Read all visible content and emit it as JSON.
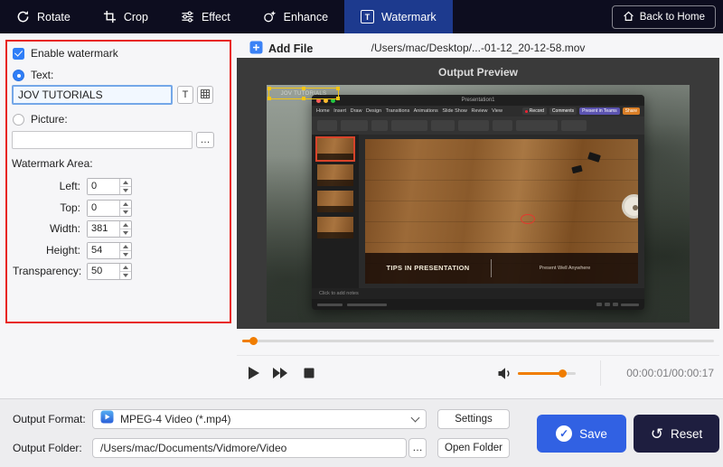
{
  "toolbar": {
    "tabs": [
      {
        "label": "Rotate"
      },
      {
        "label": "Crop"
      },
      {
        "label": "Effect"
      },
      {
        "label": "Enhance"
      },
      {
        "label": "Watermark"
      }
    ],
    "active_tab": "Watermark",
    "back_to_home_label": "Back to Home"
  },
  "watermark_panel": {
    "enable_label": "Enable watermark",
    "text_option_label": "Text:",
    "text_value": "JOV TUTORIALS",
    "text_style_button": "T",
    "picture_option_label": "Picture:",
    "picture_path_value": "",
    "browse_label": "…",
    "area_title": "Watermark Area:",
    "fields": [
      {
        "label": "Left:",
        "value": "0"
      },
      {
        "label": "Top:",
        "value": "0"
      },
      {
        "label": "Width:",
        "value": "381"
      },
      {
        "label": "Height:",
        "value": "54"
      },
      {
        "label": "Transparency:",
        "value": "50"
      }
    ]
  },
  "preview": {
    "add_file_label": "Add File",
    "file_path": "/Users/mac/Desktop/...-01-12_20-12-58.mov",
    "title": "Output Preview",
    "time_display": "00:00:01/00:00:17",
    "watermark_overlay_text": "JOV TUTORIALS",
    "ppt": {
      "window_title": "Presentation1",
      "ribbon_tabs": "Home   Insert   Draw   Design   Transitions   Animations   Slide Show   Review   View",
      "record_label": "Record",
      "comments_label": "Comments",
      "teams_label": "Present in Teams",
      "share_label": "Share",
      "slide_title": "TIPS IN PRESENTATION",
      "slide_subtitle": "Present Well Anywhere",
      "notes_placeholder": "Click to add notes"
    }
  },
  "output": {
    "format_label": "Output Format:",
    "format_value": "MPEG-4 Video (*.mp4)",
    "settings_label": "Settings",
    "folder_label": "Output Folder:",
    "folder_value": "/Users/mac/Documents/Vidmore/Video",
    "browse_label": "…",
    "open_folder_label": "Open Folder",
    "save_label": "Save",
    "reset_label": "Reset"
  },
  "colors": {
    "accent_orange": "#f07d00",
    "save_blue": "#3161e3",
    "reset_navy": "#1e1e3f",
    "active_tab_blue": "#1d3a8e",
    "panel_highlight_red": "#e8251f"
  }
}
